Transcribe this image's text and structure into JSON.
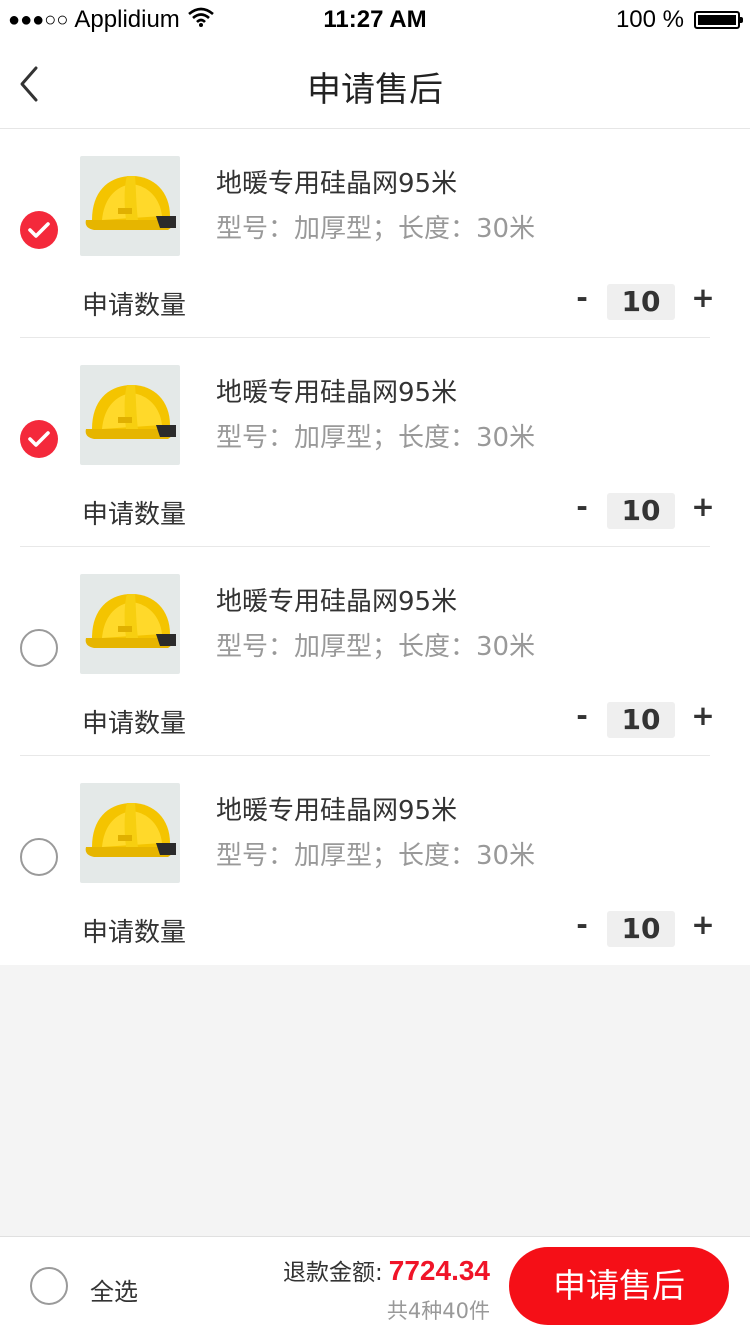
{
  "status_bar": {
    "signal": "●●●○○",
    "carrier": "Applidium",
    "time": "11:27 AM",
    "battery": "100 %"
  },
  "nav": {
    "title": "申请售后",
    "back_icon": "chevron-left-icon"
  },
  "items": [
    {
      "selected": true,
      "name": "地暖专用硅晶网95米",
      "spec": "型号：加厚型；长度：30米",
      "qty_label": "申请数量",
      "minus": "-",
      "qty": "10",
      "plus": "+"
    },
    {
      "selected": true,
      "name": "地暖专用硅晶网95米",
      "spec": "型号：加厚型；长度：30米",
      "qty_label": "申请数量",
      "minus": "-",
      "qty": "10",
      "plus": "+"
    },
    {
      "selected": false,
      "name": "地暖专用硅晶网95米",
      "spec": "型号：加厚型；长度：30米",
      "qty_label": "申请数量",
      "minus": "-",
      "qty": "10",
      "plus": "+"
    },
    {
      "selected": false,
      "name": "地暖专用硅晶网95米",
      "spec": "型号：加厚型；长度：30米",
      "qty_label": "申请数量",
      "minus": "-",
      "qty": "10",
      "plus": "+"
    }
  ],
  "bottom_bar": {
    "select_all": "全选",
    "refund_label": "退款金额:",
    "refund_amount": "7724.34",
    "summary": "共4种40件",
    "submit": "申请售后"
  },
  "colors": {
    "accent": "#f50f17",
    "check_on": "#f4293b",
    "amount": "#f01428"
  }
}
